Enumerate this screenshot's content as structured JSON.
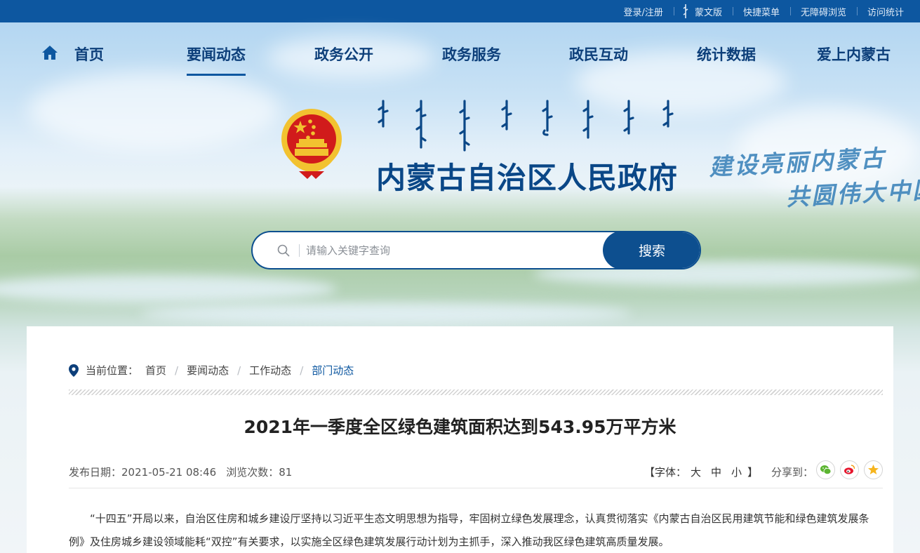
{
  "topbar": {
    "links": [
      "登录/注册",
      "蒙文版",
      "快捷菜单",
      "无障碍浏览",
      "访问统计"
    ]
  },
  "nav": {
    "items": [
      "首页",
      "要闻动态",
      "政务公开",
      "政务服务",
      "政民互动",
      "统计数据",
      "爱上内蒙古"
    ],
    "active": "要闻动态"
  },
  "site": {
    "title": "内蒙古自治区人民政府",
    "slogan_line1": "建设亮丽内蒙古",
    "slogan_line2": "共圆伟大中国梦"
  },
  "search": {
    "placeholder": "请输入关键字查询",
    "button": "搜索"
  },
  "breadcrumb": {
    "label": "当前位置：",
    "items": [
      "首页",
      "要闻动态",
      "工作动态",
      "部门动态"
    ]
  },
  "article": {
    "title": "2021年一季度全区绿色建筑面积达到543.95万平方米",
    "date_label": "发布日期：",
    "date": "2021-05-21 08:46",
    "views_label": "浏览次数：",
    "views": "81",
    "font_open": "【字体：",
    "font_large": "大",
    "font_medium": "中",
    "font_small": "小",
    "font_close": "】",
    "share_label": "分享到：",
    "paragraph": "“十四五”开局以来，自治区住房和城乡建设厅坚持以习近平生态文明思想为指导，牢固树立绿色发展理念，认真贯彻落实《内蒙古自治区民用建筑节能和绿色建筑发展条例》及住房城乡建设领域能耗“双控”有关要求，以实施全区绿色建筑发展行动计划为主抓手，深入推动我区绿色建筑高质量发展。"
  },
  "colors": {
    "topbar": "#0d57a0",
    "nav_text": "#0d3f7a",
    "title_blue": "#0a4787",
    "search_button": "#0d4f8f",
    "emblem_red": "#d11b1b",
    "emblem_gold": "#f2c230"
  },
  "icons": [
    "mongolian-script-icon",
    "home-icon",
    "search-icon",
    "location-pin-icon",
    "wechat-icon",
    "weibo-icon",
    "favorite-star-icon"
  ]
}
